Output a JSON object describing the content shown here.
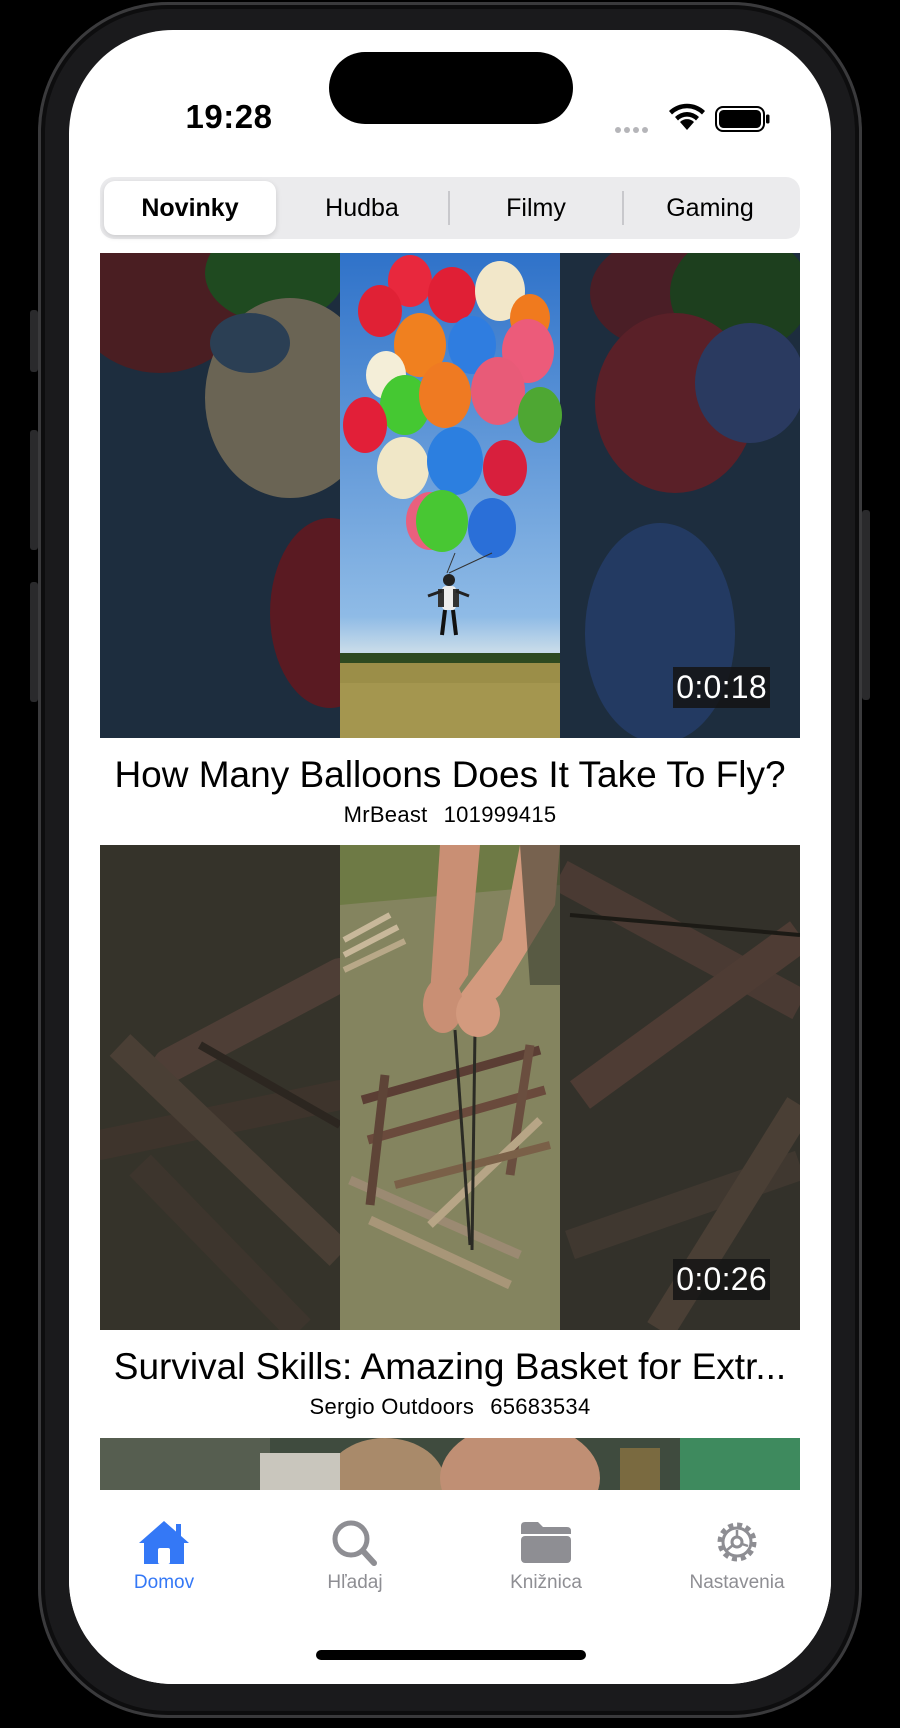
{
  "status_bar": {
    "time": "19:28",
    "icons": [
      "cellular-icon",
      "wifi-icon",
      "battery-icon"
    ]
  },
  "segments": {
    "items": [
      {
        "label": "Novinky",
        "selected": true
      },
      {
        "label": "Hudba",
        "selected": false
      },
      {
        "label": "Filmy",
        "selected": false
      },
      {
        "label": "Gaming",
        "selected": false
      }
    ]
  },
  "feed": {
    "videos": [
      {
        "title": "How Many Balloons Does It Take To Fly?",
        "channel": "MrBeast",
        "views": "101999415",
        "duration": "0:0:18"
      },
      {
        "title": "Survival Skills: Amazing Basket for Extr...",
        "channel": "Sergio Outdoors",
        "views": "65683534",
        "duration": "0:0:26"
      }
    ]
  },
  "tab_bar": {
    "items": [
      {
        "label": "Domov",
        "icon": "house-icon",
        "active": true
      },
      {
        "label": "Hľadaj",
        "icon": "search-icon",
        "active": false
      },
      {
        "label": "Knižnica",
        "icon": "folder-icon",
        "active": false
      },
      {
        "label": "Nastavenia",
        "icon": "gear-icon",
        "active": false
      }
    ]
  },
  "colors": {
    "accent": "#3478f6",
    "inactive_tab": "#8e8e93",
    "segment_background": "#ebebed"
  }
}
